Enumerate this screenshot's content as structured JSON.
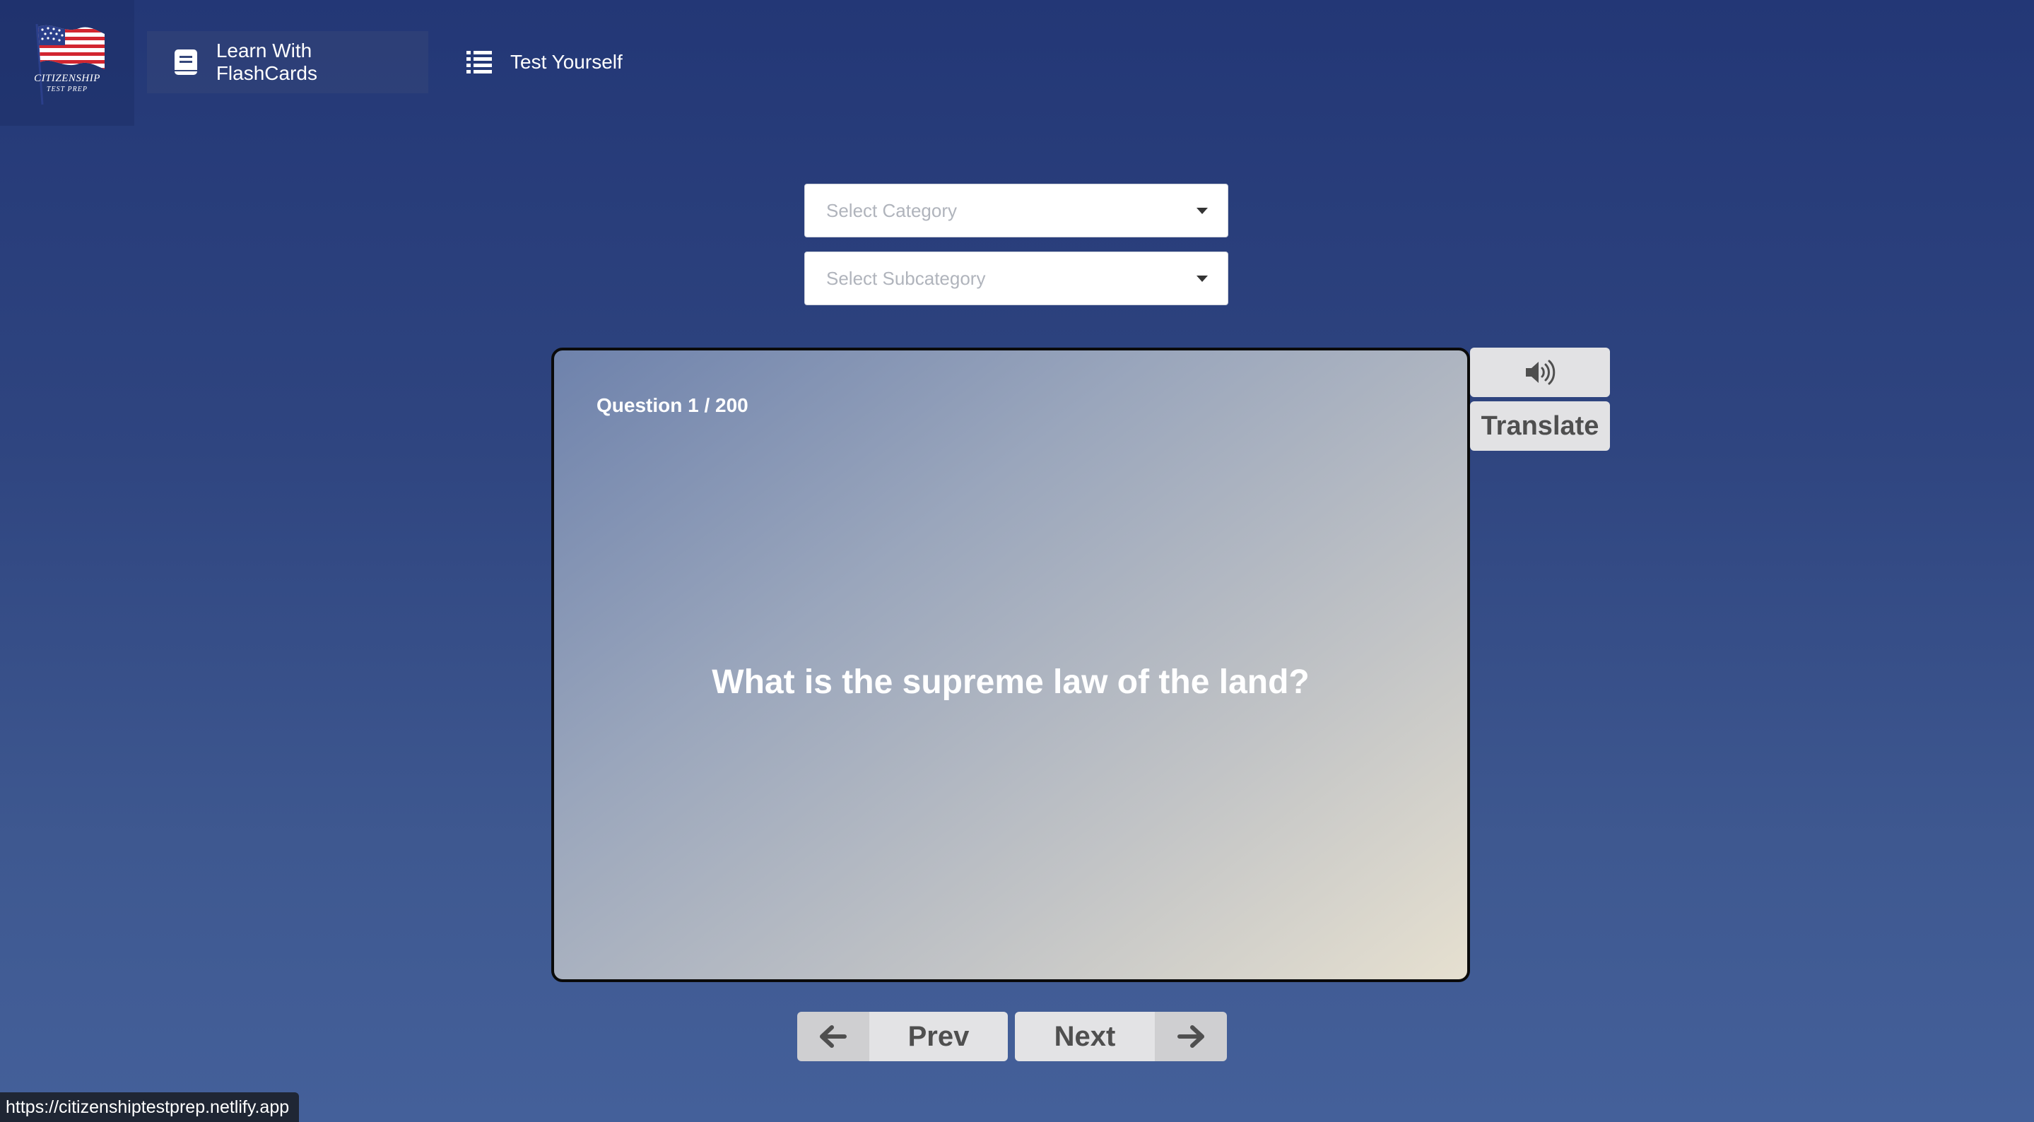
{
  "header": {
    "logo": {
      "line1": "CITIZENSHIP",
      "line2": "TEST PREP",
      "icon": "us-flag-icon"
    },
    "nav": [
      {
        "label": "Learn With FlashCards",
        "icon": "book-icon",
        "active": true
      },
      {
        "label": "Test Yourself",
        "icon": "list-icon",
        "active": false
      }
    ]
  },
  "filters": {
    "category_placeholder": "Select Category",
    "subcategory_placeholder": "Select Subcategory"
  },
  "card": {
    "counter": "Question 1 / 200",
    "question": "What is the supreme law of the land?"
  },
  "side_buttons": {
    "speak_icon": "speaker-icon",
    "translate_label": "Translate"
  },
  "pager": {
    "prev_label": "Prev",
    "next_label": "Next"
  },
  "status_bar": {
    "url": "https://citizenshiptestprep.netlify.app"
  },
  "colors": {
    "background_top": "#233776",
    "background_bottom": "#44609a",
    "button_bg": "#e2e2e4",
    "button_text": "#4f4f4f"
  }
}
